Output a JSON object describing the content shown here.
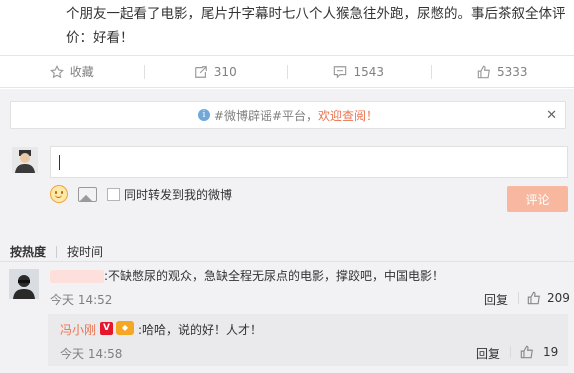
{
  "post": {
    "text": "个朋友一起看了电影，尾片升字幕时七八个人猴急往外跑，尿憋的。事后茶叙全体评价：好看！"
  },
  "actions": {
    "favorite_label": "收藏",
    "repost_count": "310",
    "comment_count": "1543",
    "like_count": "5333"
  },
  "notice": {
    "tag": "#微博辟谣#平台，",
    "welcome": "欢迎查阅！",
    "close": "✕"
  },
  "composer": {
    "input_value": "",
    "repost_checkbox_label": "同时转发到我的微博",
    "submit_label": "评论"
  },
  "sort": {
    "by_hot": "按热度",
    "by_time": "按时间"
  },
  "comment": {
    "username": "",
    "text": ":不缺憋尿的观众，急缺全程无尿点的电影，撑跤吧，中国电影！",
    "time": "今天 14:52",
    "reply_label": "回复",
    "likes": "209"
  },
  "reply": {
    "username": "冯小刚",
    "verified_badge": "V",
    "text": ":哈哈，说的好！人才！",
    "time": "今天 14:58",
    "reply_label": "回复",
    "likes": "19"
  },
  "colors": {
    "accent": "#eb7350",
    "panel_bg": "#f2f2f5",
    "submit_disabled": "#f7b89f",
    "verified_red": "#e6162d"
  }
}
